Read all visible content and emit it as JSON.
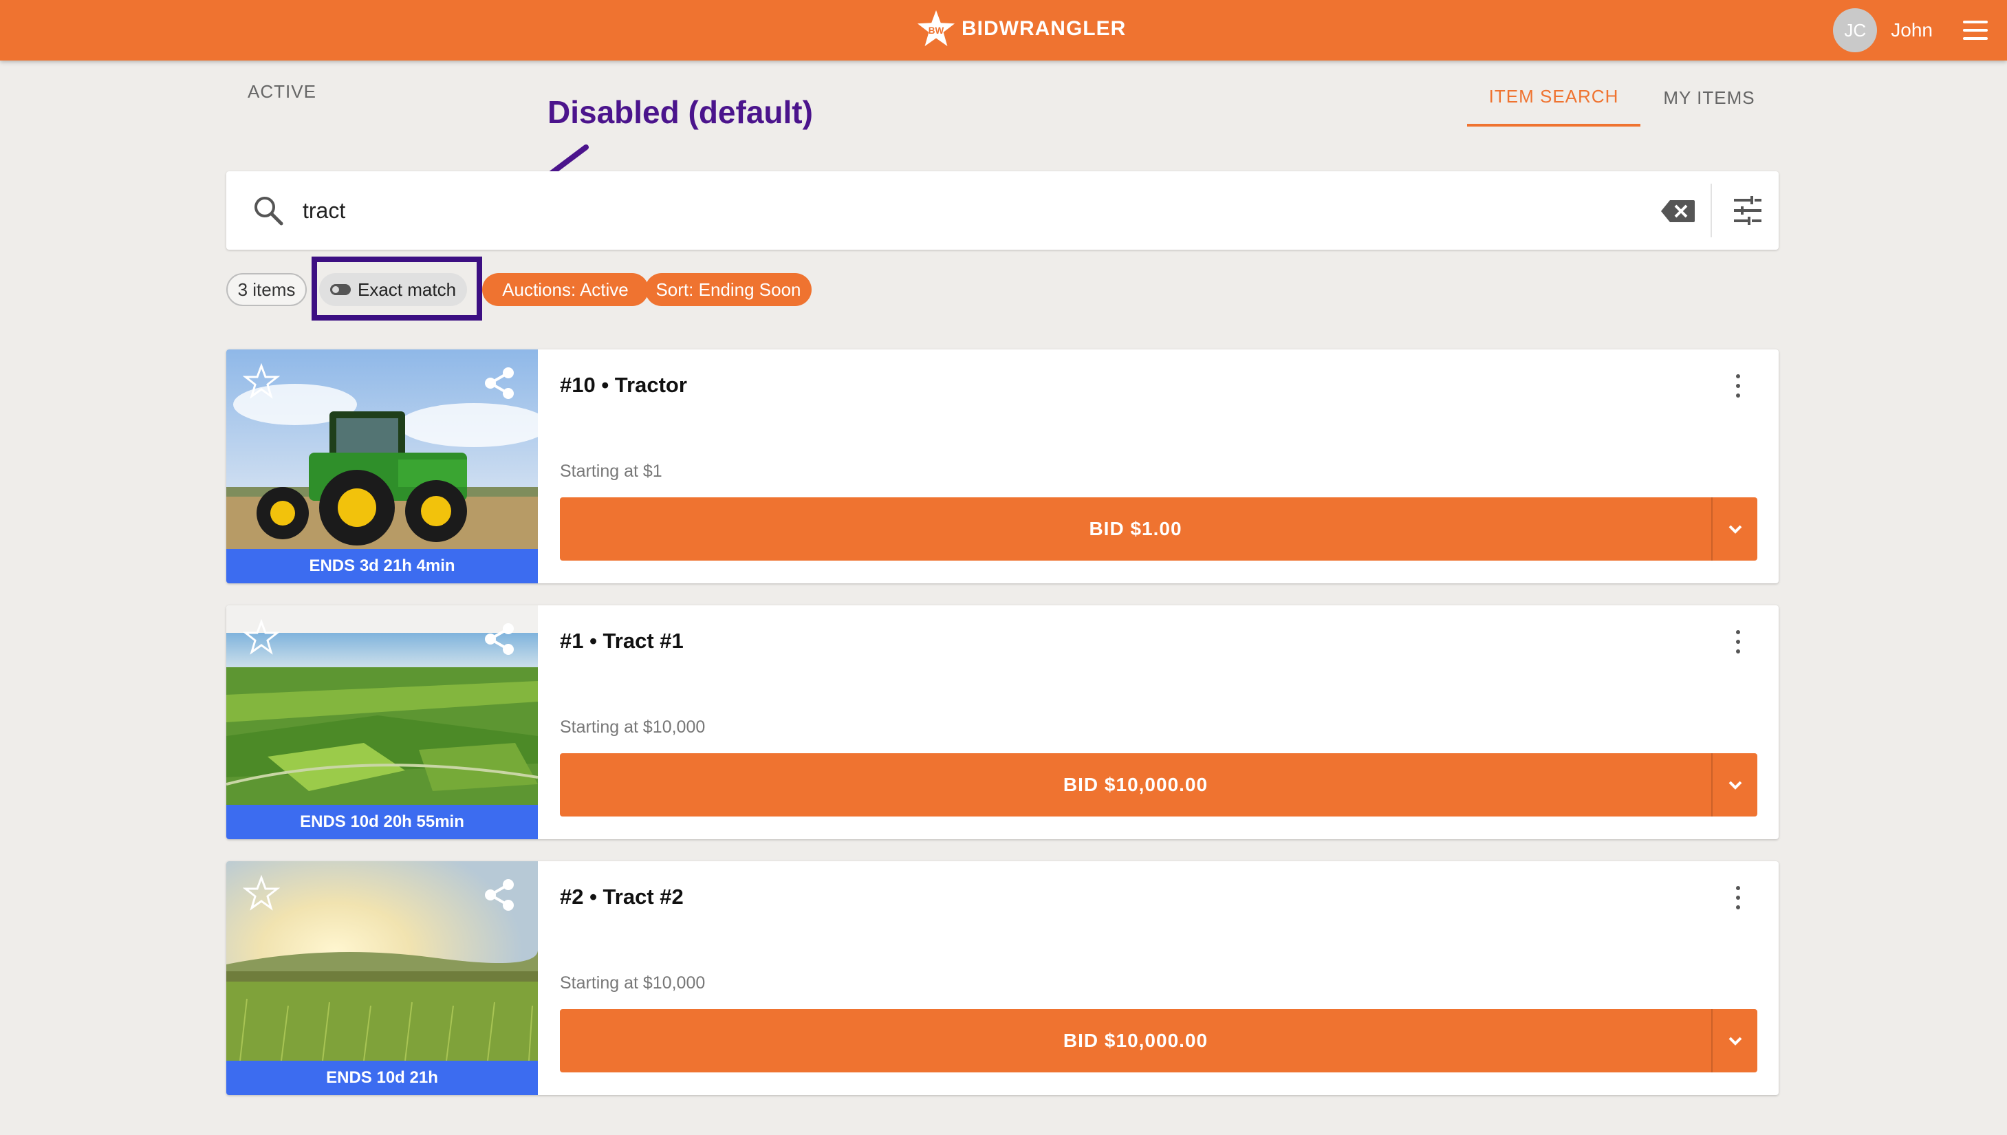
{
  "header": {
    "brand": "BIDWRANGLER",
    "brand_badge": "BW",
    "avatar_initials": "JC",
    "user_name": "John"
  },
  "nav": {
    "active_label": "ACTIVE",
    "tabs": [
      {
        "label": "ITEM SEARCH",
        "selected": true
      },
      {
        "label": "MY ITEMS",
        "selected": false
      }
    ]
  },
  "annotation": {
    "label": "Disabled (default)"
  },
  "search": {
    "value": "tract",
    "placeholder": ""
  },
  "chips": {
    "count": "3 items",
    "exact_match": "Exact match",
    "auctions": "Auctions: Active",
    "sort": "Sort: Ending Soon"
  },
  "items": [
    {
      "title": "#10 • Tractor",
      "starting": "Starting at $1",
      "bid_label": "BID $1.00",
      "ends": "ENDS 3d 21h 4min"
    },
    {
      "title": "#1 • Tract #1",
      "starting": "Starting at $10,000",
      "bid_label": "BID $10,000.00",
      "ends": "ENDS 10d 20h 55min"
    },
    {
      "title": "#2 • Tract #2",
      "starting": "Starting at $10,000",
      "bid_label": "BID $10,000.00",
      "ends": "ENDS 10d 21h"
    }
  ],
  "colors": {
    "brand_orange": "#ef7330",
    "annotation_purple": "#4b148c",
    "ends_blue": "#3c6cf0"
  },
  "icons": [
    "star-logo-icon",
    "menu-icon",
    "search-icon",
    "backspace-clear-icon",
    "tune-filter-icon",
    "toggle-off-icon",
    "star-outline-icon",
    "share-icon",
    "more-vert-icon",
    "chevron-down-icon"
  ]
}
